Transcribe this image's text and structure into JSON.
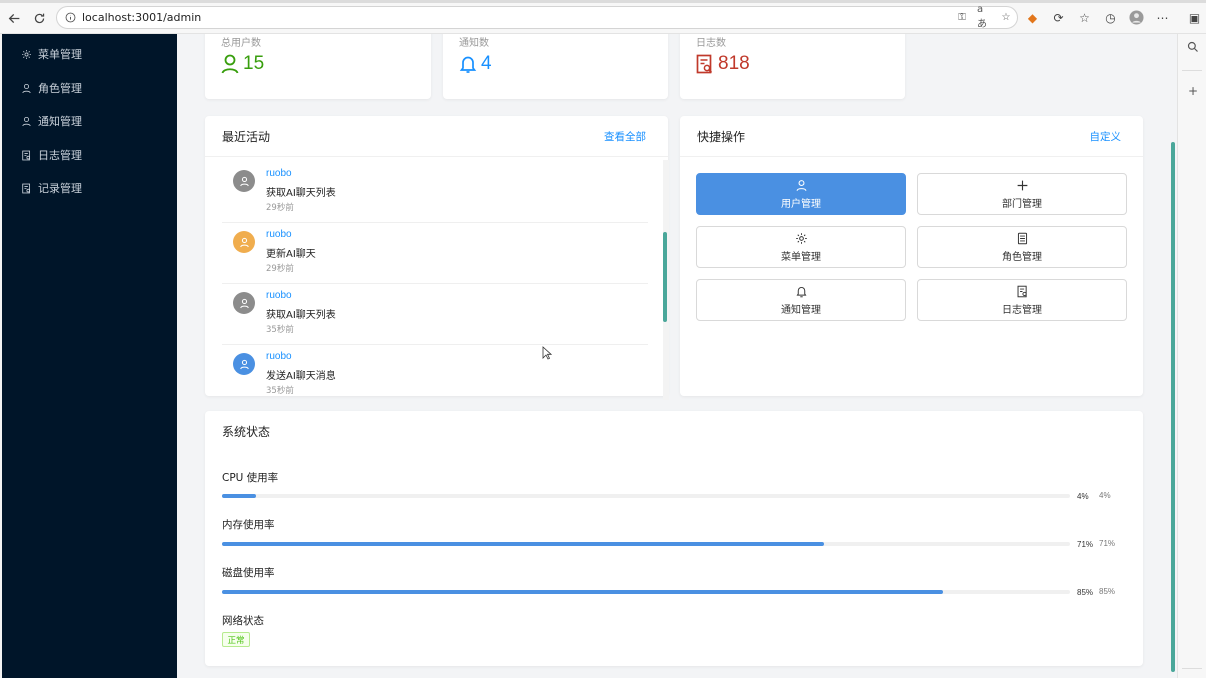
{
  "browser": {
    "url": "localhost:3001/admin"
  },
  "sidebar": {
    "items": [
      {
        "label": "菜单管理",
        "icon": "gear-icon"
      },
      {
        "label": "角色管理",
        "icon": "user-icon"
      },
      {
        "label": "通知管理",
        "icon": "user-icon"
      },
      {
        "label": "日志管理",
        "icon": "log-icon"
      },
      {
        "label": "记录管理",
        "icon": "log-icon"
      }
    ]
  },
  "stats": [
    {
      "label": "总用户数",
      "value": "15",
      "color": "#389e0d",
      "icon": "user-icon"
    },
    {
      "label": "通知数",
      "value": "4",
      "color": "#1890ff",
      "icon": "bell-icon"
    },
    {
      "label": "日志数",
      "value": "818",
      "color": "#c0392b",
      "icon": "log-search-icon"
    }
  ],
  "activity": {
    "title": "最近活动",
    "view_all": "查看全部",
    "items": [
      {
        "user": "ruobo",
        "action": "获取AI聊天列表",
        "time": "29秒前",
        "avatar_color": "#8c8c8c"
      },
      {
        "user": "ruobo",
        "action": "更新AI聊天",
        "time": "29秒前",
        "avatar_color": "#f0ad4e"
      },
      {
        "user": "ruobo",
        "action": "获取AI聊天列表",
        "time": "35秒前",
        "avatar_color": "#8c8c8c"
      },
      {
        "user": "ruobo",
        "action": "发送AI聊天消息",
        "time": "35秒前",
        "avatar_color": "#4a90e2"
      }
    ]
  },
  "quick": {
    "title": "快捷操作",
    "customize": "自定义",
    "buttons": [
      {
        "label": "用户管理",
        "icon": "user-icon",
        "primary": true
      },
      {
        "label": "部门管理",
        "icon": "plus-icon",
        "primary": false
      },
      {
        "label": "菜单管理",
        "icon": "gear-icon",
        "primary": false
      },
      {
        "label": "角色管理",
        "icon": "calculator-icon",
        "primary": false
      },
      {
        "label": "通知管理",
        "icon": "bell-icon",
        "primary": false
      },
      {
        "label": "日志管理",
        "icon": "log-search-icon",
        "primary": false
      }
    ]
  },
  "system": {
    "title": "系统状态",
    "metrics": [
      {
        "label": "CPU 使用率",
        "percent": 4,
        "text": "4%",
        "text2": "4%"
      },
      {
        "label": "内存使用率",
        "percent": 71,
        "text": "71%",
        "text2": "71%"
      },
      {
        "label": "磁盘使用率",
        "percent": 85,
        "text": "85%",
        "text2": "85%"
      }
    ],
    "network_label": "网络状态",
    "network_status": "正常",
    "network_color": "#52c41a"
  }
}
